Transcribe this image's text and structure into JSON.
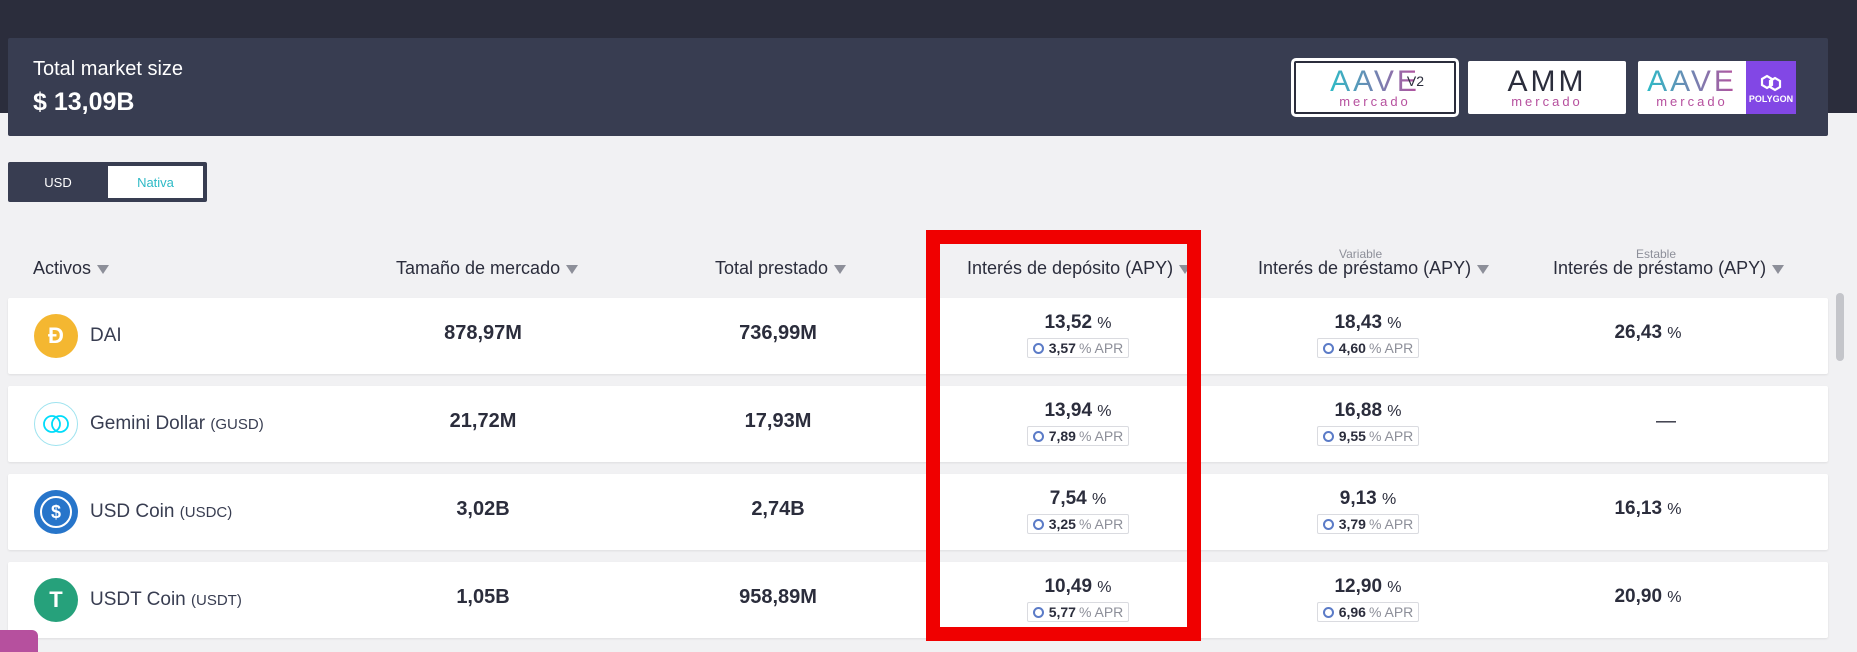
{
  "header": {
    "title": "Total market size",
    "value": "$ 13,09B"
  },
  "markets": [
    {
      "logo": "AAVE",
      "sub": "mercado",
      "tag": "V2",
      "active": true
    },
    {
      "logo": "AMM",
      "sub": "mercado"
    },
    {
      "logo": "AAVE",
      "sub": "mercado",
      "badge": "POLYGON"
    }
  ],
  "toggle": {
    "usd": "USD",
    "native": "Nativa"
  },
  "columns": {
    "assets": "Activos",
    "market_size": "Tamaño de mercado",
    "total_borrowed": "Total prestado",
    "deposit_apy": "Interés de depósito (APY)",
    "variable_label": "Variable",
    "variable_borrow": "Interés de préstamo (APY)",
    "stable_label": "Estable",
    "stable_borrow": "Interés de préstamo (APY)"
  },
  "rows": [
    {
      "name": "DAI",
      "symbol": "",
      "icon_color": "#f4b731",
      "icon": "dai-icon",
      "glyph": "Đ",
      "market_size": "878,97M",
      "borrowed": "736,99M",
      "deposit": "13,52",
      "deposit_apr": "3,57",
      "variable": "18,43",
      "variable_apr": "4,60",
      "stable": "26,43"
    },
    {
      "name": "Gemini Dollar",
      "symbol": "(GUSD)",
      "icon_color": "#ffffff",
      "icon": "gusd-icon",
      "glyph": "",
      "market_size": "21,72M",
      "borrowed": "17,93M",
      "deposit": "13,94",
      "deposit_apr": "7,89",
      "variable": "16,88",
      "variable_apr": "9,55",
      "stable": "—"
    },
    {
      "name": "USD Coin",
      "symbol": "(USDC)",
      "icon_color": "#2775ca",
      "icon": "usdc-icon",
      "glyph": "$",
      "market_size": "3,02B",
      "borrowed": "2,74B",
      "deposit": "7,54",
      "deposit_apr": "3,25",
      "variable": "9,13",
      "variable_apr": "3,79",
      "stable": "16,13"
    },
    {
      "name": "USDT Coin",
      "symbol": "(USDT)",
      "icon_color": "#26a17b",
      "icon": "usdt-icon",
      "glyph": "T",
      "market_size": "1,05B",
      "borrowed": "958,89M",
      "deposit": "10,49",
      "deposit_apr": "5,77",
      "variable": "12,90",
      "variable_apr": "6,96",
      "stable": "20,90"
    }
  ],
  "labels": {
    "percent": "%",
    "apr": "% APR"
  },
  "colors": {
    "dark": "#2b2d3c",
    "card": "#383d51",
    "highlight": "#f00000",
    "accent": "#2ebac6",
    "pink": "#b6509e"
  }
}
